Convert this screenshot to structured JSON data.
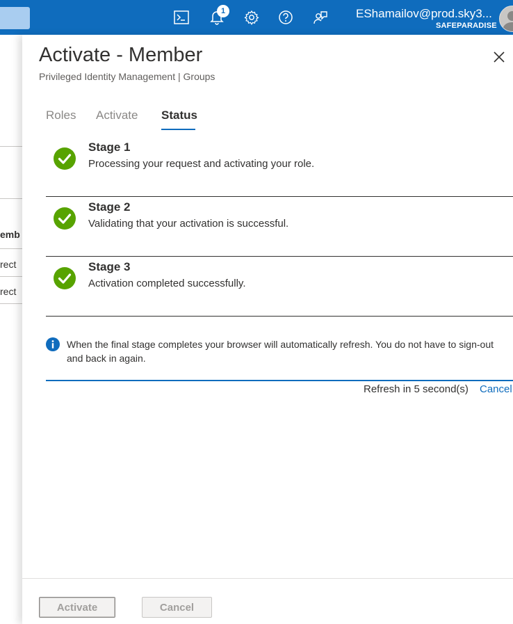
{
  "topbar": {
    "user_name": "EShamailov@prod.sky3...",
    "tenant": "SAFEPARADISE",
    "notification_count": "1",
    "icons": [
      "cloud-shell-icon",
      "bell-icon",
      "gear-icon",
      "help-icon",
      "feedback-icon"
    ],
    "accent": "#0f6cbd"
  },
  "background_page": {
    "header_fragment": "emb",
    "row_values": [
      "rect",
      "rect"
    ]
  },
  "panel": {
    "title": "Activate - Member",
    "subtitle": "Privileged Identity Management | Groups",
    "tabs": [
      {
        "label": "Roles",
        "active": false
      },
      {
        "label": "Activate",
        "active": false
      },
      {
        "label": "Status",
        "active": true
      }
    ],
    "stages": [
      {
        "title": "Stage 1",
        "description": "Processing your request and activating your role.",
        "status": "complete"
      },
      {
        "title": "Stage 2",
        "description": "Validating that your activation is successful.",
        "status": "complete"
      },
      {
        "title": "Stage 3",
        "description": "Activation completed successfully.",
        "status": "complete"
      }
    ],
    "info_message": "When the final stage completes your browser will automatically refresh. You do not have to sign-out and back in again.",
    "refresh_text": "Refresh in 5 second(s)",
    "cancel_link": "Cancel",
    "footer": {
      "activate_label": "Activate",
      "cancel_label": "Cancel"
    },
    "status_color": "#57a300"
  }
}
